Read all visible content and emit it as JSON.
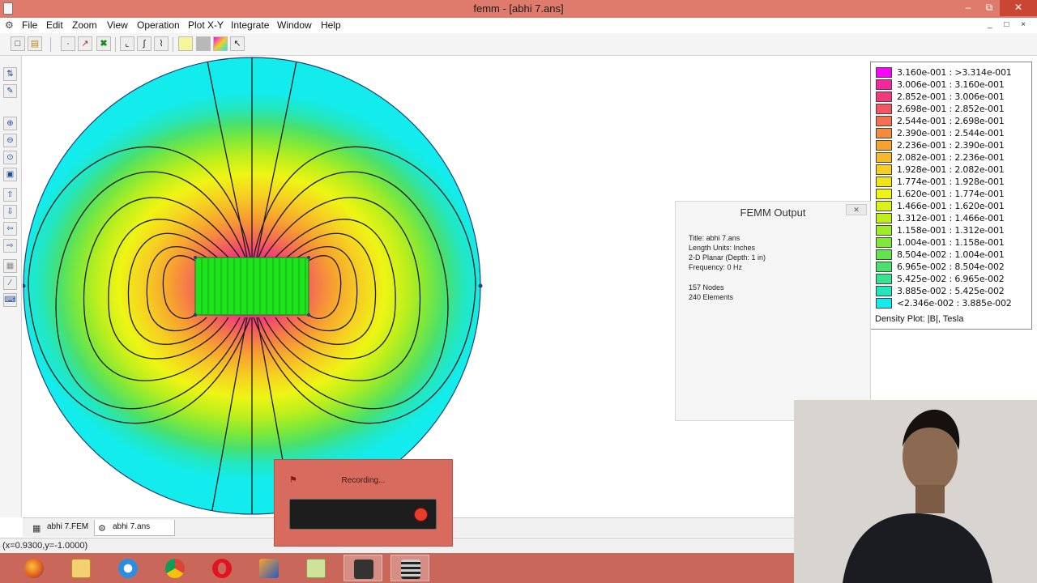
{
  "window": {
    "title": "femm - [abhi 7.ans]",
    "min_label": "–",
    "max_label": "⧉",
    "close_label": "✕"
  },
  "menu": {
    "items": [
      "File",
      "Edit",
      "Zoom",
      "View",
      "Operation",
      "Plot X-Y",
      "Integrate",
      "Window",
      "Help"
    ],
    "mdi_buttons": "_ □ ×"
  },
  "legend": {
    "rows": [
      {
        "label": "3.160e-001 : >3.314e-001",
        "color": "#ff00ff"
      },
      {
        "label": "3.006e-001 : 3.160e-001",
        "color": "#f5269f"
      },
      {
        "label": "2.852e-001 : 3.006e-001",
        "color": "#f2397a"
      },
      {
        "label": "2.698e-001 : 2.852e-001",
        "color": "#f25662"
      },
      {
        "label": "2.544e-001 : 2.698e-001",
        "color": "#f47050"
      },
      {
        "label": "2.390e-001 : 2.544e-001",
        "color": "#f68a3c"
      },
      {
        "label": "2.236e-001 : 2.390e-001",
        "color": "#f7a22f"
      },
      {
        "label": "2.082e-001 : 2.236e-001",
        "color": "#f7b82a"
      },
      {
        "label": "1.928e-001 : 2.082e-001",
        "color": "#f6cf22"
      },
      {
        "label": "1.774e-001 : 1.928e-001",
        "color": "#f2e41a"
      },
      {
        "label": "1.620e-001 : 1.774e-001",
        "color": "#eef514"
      },
      {
        "label": "1.466e-001 : 1.620e-001",
        "color": "#daf216"
      },
      {
        "label": "1.312e-001 : 1.466e-001",
        "color": "#bcef1c"
      },
      {
        "label": "1.158e-001 : 1.312e-001",
        "color": "#9eec28"
      },
      {
        "label": "1.004e-001 : 1.158e-001",
        "color": "#7ee839"
      },
      {
        "label": "8.504e-002 : 1.004e-001",
        "color": "#62e44f"
      },
      {
        "label": "6.965e-002 : 8.504e-002",
        "color": "#4ae06c"
      },
      {
        "label": "5.425e-002 : 6.965e-002",
        "color": "#38e291"
      },
      {
        "label": "3.885e-002 : 5.425e-002",
        "color": "#24e6bb"
      },
      {
        "label": "<2.346e-002 : 3.885e-002",
        "color": "#13ecec"
      }
    ],
    "caption": "Density Plot: |B|, Tesla"
  },
  "output": {
    "title": "FEMM Output",
    "lines": [
      "Title: abhi 7.ans",
      "Length Units: Inches",
      "2-D Planar (Depth: 1 in)",
      "Frequency: 0 Hz",
      "157 Nodes",
      "240 Elements"
    ]
  },
  "tabs": [
    {
      "label": "abhi 7.FEM"
    },
    {
      "label": "abhi 7.ans"
    }
  ],
  "status": {
    "coords": "(x=0.9300,y=-1.0000)"
  },
  "recording": {
    "label": "Recording..."
  },
  "colors": {
    "titlebar": "#df7b6d",
    "taskbar": "#c8675a",
    "outer_region": "#13ecec",
    "coil": "#1de31d",
    "contour": "#1a1a1a"
  },
  "toolbar": {
    "top_icons": [
      "new-file-icon",
      "open-file-icon",
      "point-icon",
      "line-icon",
      "mesh-icon",
      "contour-icon",
      "integral-icon",
      "circuit-icon",
      "yellow-box-icon",
      "grey-box-icon",
      "density-plot-icon",
      "arrow-icon"
    ],
    "left_icons": [
      "block-label-icon",
      "edit-icon",
      "zoom-in-icon",
      "zoom-out-icon",
      "zoom-natural-icon",
      "zoom-window-icon",
      "pan-up-icon",
      "pan-down-icon",
      "pan-left-icon",
      "pan-right-icon",
      "grid-icon",
      "snap-icon",
      "keyboard-icon"
    ]
  },
  "taskbar": {
    "items": [
      "firefox-icon",
      "explorer-icon",
      "internet-explorer-icon",
      "chrome-icon",
      "opera-icon",
      "winamp-icon",
      "notes-icon",
      "recorder-icon",
      "femm-icon"
    ]
  }
}
